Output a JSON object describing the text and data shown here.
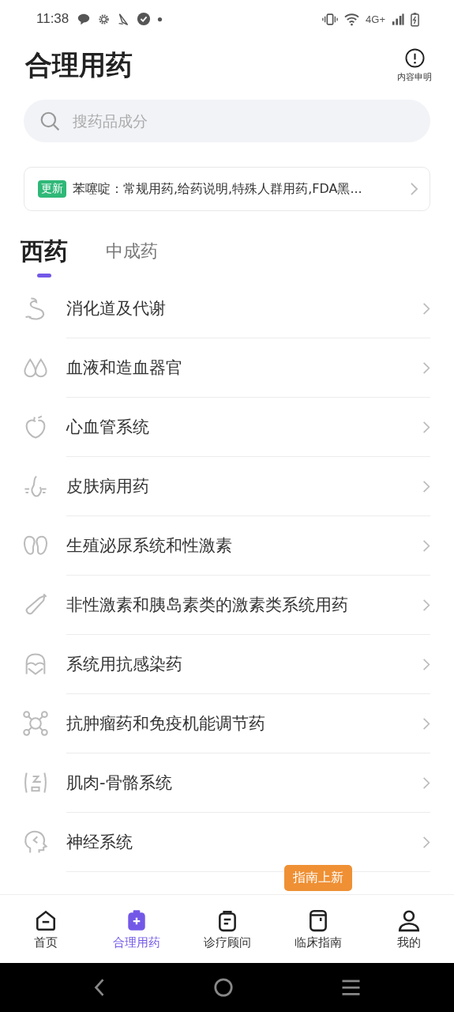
{
  "status_bar": {
    "time": "11:38",
    "network": "4G+"
  },
  "header": {
    "title": "合理用药",
    "action": "内容申明"
  },
  "search": {
    "placeholder": "搜药品成分"
  },
  "notice": {
    "badge": "更新",
    "text": "苯噻啶：常规用药,给药说明,特殊人群用药,FDA黑..."
  },
  "tabs": [
    {
      "label": "西药",
      "selected": true
    },
    {
      "label": "中成药",
      "selected": false
    }
  ],
  "categories": [
    {
      "label": "消化道及代谢"
    },
    {
      "label": "血液和造血器官"
    },
    {
      "label": "心血管系统"
    },
    {
      "label": "皮肤病用药"
    },
    {
      "label": "生殖泌尿系统和性激素"
    },
    {
      "label": "非性激素和胰岛素类的激素类系统用药"
    },
    {
      "label": "系统用抗感染药"
    },
    {
      "label": "抗肿瘤药和免疫机能调节药"
    },
    {
      "label": "肌肉-骨骼系统"
    },
    {
      "label": "神经系统"
    }
  ],
  "bottom_nav": {
    "tooltip": "指南上新",
    "items": [
      {
        "label": "首页",
        "selected": false
      },
      {
        "label": "合理用药",
        "selected": true
      },
      {
        "label": "诊疗顾问",
        "selected": false
      },
      {
        "label": "临床指南",
        "selected": false
      },
      {
        "label": "我的",
        "selected": false
      }
    ]
  }
}
